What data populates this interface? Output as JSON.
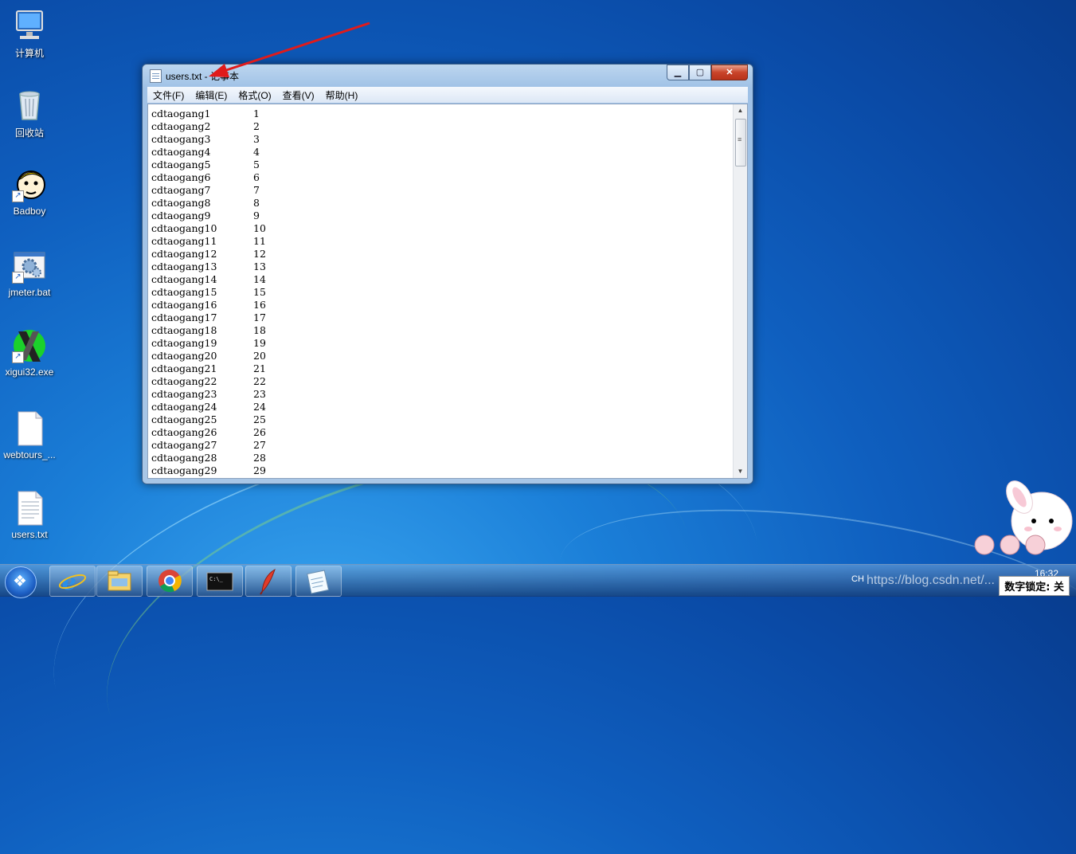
{
  "desktop": {
    "icons": [
      {
        "label": "计算机"
      },
      {
        "label": "回收站"
      },
      {
        "label": "Badboy"
      },
      {
        "label": "jmeter.bat"
      },
      {
        "label": "xigui32.exe"
      },
      {
        "label": "webtours_..."
      },
      {
        "label": "users.txt"
      }
    ]
  },
  "window": {
    "title": "users.txt - 记事本",
    "menu": [
      "文件(F)",
      "编辑(E)",
      "格式(O)",
      "查看(V)",
      "帮助(H)"
    ],
    "lines": [
      [
        "cdtaogang1",
        "1"
      ],
      [
        "cdtaogang2",
        "2"
      ],
      [
        "cdtaogang3",
        "3"
      ],
      [
        "cdtaogang4",
        "4"
      ],
      [
        "cdtaogang5",
        "5"
      ],
      [
        "cdtaogang6",
        "6"
      ],
      [
        "cdtaogang7",
        "7"
      ],
      [
        "cdtaogang8",
        "8"
      ],
      [
        "cdtaogang9",
        "9"
      ],
      [
        "cdtaogang10",
        "10"
      ],
      [
        "cdtaogang11",
        "11"
      ],
      [
        "cdtaogang12",
        "12"
      ],
      [
        "cdtaogang13",
        "13"
      ],
      [
        "cdtaogang14",
        "14"
      ],
      [
        "cdtaogang15",
        "15"
      ],
      [
        "cdtaogang16",
        "16"
      ],
      [
        "cdtaogang17",
        "17"
      ],
      [
        "cdtaogang18",
        "18"
      ],
      [
        "cdtaogang19",
        "19"
      ],
      [
        "cdtaogang20",
        "20"
      ],
      [
        "cdtaogang21",
        "21"
      ],
      [
        "cdtaogang22",
        "22"
      ],
      [
        "cdtaogang23",
        "23"
      ],
      [
        "cdtaogang24",
        "24"
      ],
      [
        "cdtaogang25",
        "25"
      ],
      [
        "cdtaogang26",
        "26"
      ],
      [
        "cdtaogang27",
        "27"
      ],
      [
        "cdtaogang28",
        "28"
      ],
      [
        "cdtaogang29",
        "29"
      ]
    ]
  },
  "taskbar": {
    "apps": [
      "internet-explorer-icon",
      "file-explorer-icon",
      "chrome-icon",
      "command-prompt-icon",
      "feather-app-icon",
      "notepad-icon"
    ],
    "tray": {
      "lang": "CH",
      "time": "16:32"
    },
    "numlock": "数字锁定: 关",
    "watermark": "https://blog.csdn.net/..."
  }
}
